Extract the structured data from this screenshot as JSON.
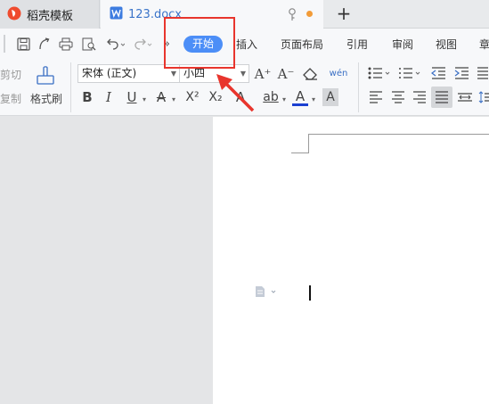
{
  "tabs": {
    "dao_label": "稻壳模板",
    "doc_label": "123.docx",
    "new_tab": "+"
  },
  "quick_access": {
    "more": "»"
  },
  "menu": {
    "items": [
      "开始",
      "插入",
      "页面布局",
      "引用",
      "审阅",
      "视图",
      "章"
    ]
  },
  "ribbon": {
    "cut_label": "剪切",
    "copy_label": "复制",
    "format_painter_label": "格式刷",
    "font_name": "宋体 (正文)",
    "font_size": "小四",
    "bold": "B",
    "italic": "I",
    "underline": "U",
    "strikethrough": "A",
    "superscript": "X²",
    "subscript": "X₂",
    "text_effect": "A",
    "highlight": "ab",
    "font_color": "A",
    "char_shading": "A",
    "grow_font": "A⁺",
    "shrink_font": "A⁻",
    "clear_format": "⌫",
    "phonetic": "wén"
  },
  "colors": {
    "accent": "#4c8ef7",
    "annotation": "#e8352d",
    "doc_tab_text": "#3a74c9"
  }
}
